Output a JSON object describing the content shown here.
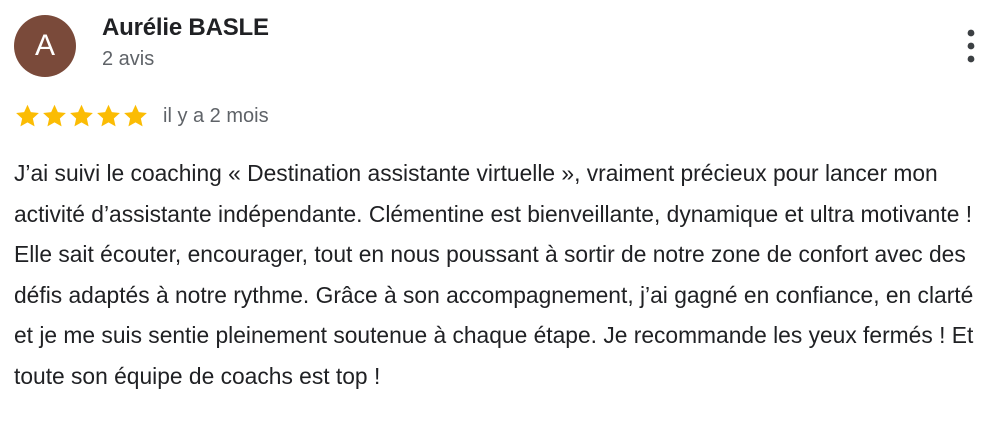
{
  "review": {
    "author": {
      "initial": "A",
      "name": "Aurélie BASLE",
      "review_count": "2 avis",
      "avatar_color": "#7a4a3a"
    },
    "rating": {
      "stars": 5,
      "max": 5,
      "star_color": "#fbbc04"
    },
    "timestamp": "il y a 2 mois",
    "text": "J’ai suivi le coaching « Destination assistante virtuelle », vraiment précieux pour lancer mon activité d’assistante indépendante. Clémentine est bienveillante, dynamique et ultra motivante ! Elle sait écouter, encourager, tout en nous poussant à sortir de notre zone de confort avec des défis adaptés à notre rythme. Grâce à son accompagnement, j’ai gagné en confiance, en clarté et je me suis sentie pleinement soutenue à chaque étape. Je recommande les yeux fermés ! Et toute son équipe de coachs est top !",
    "more_icon": "more-vert-icon"
  }
}
